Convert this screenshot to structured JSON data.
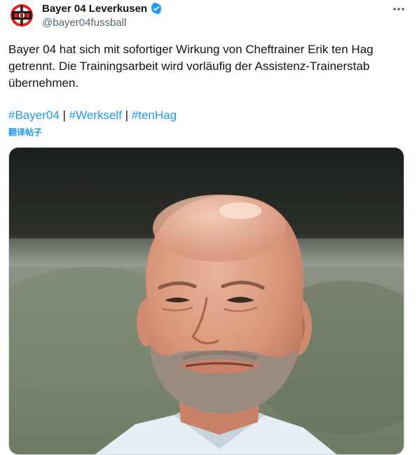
{
  "post": {
    "display_name": "Bayer 04 Leverkusen",
    "handle": "@bayer04fussball",
    "text": "Bayer 04 hat sich mit sofortiger Wirkung von Cheftrainer Erik ten Hag getrennt. Die Trainingsarbeit wird vorläufig der Assistenz-Trainerstab übernehmen.",
    "hashtags": [
      "#Bayer04",
      "#Werkself",
      "#tenHag"
    ],
    "separator": " | ",
    "translate_label": "翻译帖子",
    "more_icon": "more-horizontal-icon",
    "verified_icon": "verified-badge-icon"
  },
  "colors": {
    "link": "#1d9bf0",
    "verified": "#1d9bf0",
    "text": "#0f1419",
    "secondary": "#536471"
  }
}
